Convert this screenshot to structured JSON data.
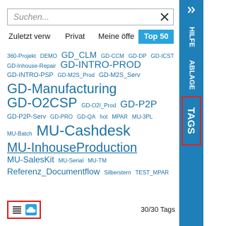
{
  "search": {
    "placeholder": "Suchen...",
    "clear_icon": "close-icon"
  },
  "tabs": [
    {
      "label": "Zuletzt verw"
    },
    {
      "label": "Privat"
    },
    {
      "label": "Meine öffer"
    },
    {
      "label": "Top 50",
      "active": true
    }
  ],
  "tags": [
    {
      "label": "360-Projekt",
      "size": "s1"
    },
    {
      "label": "DEMO",
      "size": "s1"
    },
    {
      "label": "GD_CLM",
      "size": "s3"
    },
    {
      "label": "GD-CCM",
      "size": "s1"
    },
    {
      "label": "GD-DP",
      "size": "s1"
    },
    {
      "label": "GD-ICST",
      "size": "s1"
    },
    {
      "label": "GD-Inhouse-Repair",
      "size": "s1"
    },
    {
      "label": "GD-INTRO-PROD",
      "size": "s4"
    },
    {
      "label": "GD-INTRO-PSP",
      "size": "s2"
    },
    {
      "label": "GD-M2S_Prod",
      "size": "s1"
    },
    {
      "label": "GD-M2S_Serv",
      "size": "s2"
    },
    {
      "label": "GD-Manufacturing",
      "size": "s6"
    },
    {
      "label": "GD-O2CSP",
      "size": "s6"
    },
    {
      "label": "GD-O2I_Prod",
      "size": "s1"
    },
    {
      "label": "GD-P2P",
      "size": "s4"
    },
    {
      "label": "GD-P2P-Serv",
      "size": "s2"
    },
    {
      "label": "GD-PRO",
      "size": "s1"
    },
    {
      "label": "GD-QA",
      "size": "s1"
    },
    {
      "label": "hot",
      "size": "s1"
    },
    {
      "label": "MPAR",
      "size": "s1"
    },
    {
      "label": "MU-3PL",
      "size": "s1"
    },
    {
      "label": "MU-Batch",
      "size": "s1"
    },
    {
      "label": "MU-Cashdesk",
      "size": "s7"
    },
    {
      "label": "MU-InhouseProduction",
      "size": "s5"
    },
    {
      "label": "MU-SalesKit",
      "size": "s3"
    },
    {
      "label": "MU-Serial",
      "size": "s1"
    },
    {
      "label": "MU-TM",
      "size": "s1"
    },
    {
      "label": "Referenz_Documentflow",
      "size": "s3"
    },
    {
      "label": "Silberstern",
      "size": "s1"
    },
    {
      "label": "TEST_MPAR",
      "size": "s1"
    }
  ],
  "footer": {
    "count_label": "30/30 Tags",
    "list_view_icon": "list-icon",
    "cloud_view_icon": "cloud-icon"
  },
  "sidebar": {
    "collapse_icon": "double-chevron-right-icon",
    "items": [
      {
        "label": "HILFE"
      },
      {
        "label": "ABLAGE"
      },
      {
        "label": "TAGS",
        "active": true
      }
    ]
  },
  "colors": {
    "accent": "#2aa4dc",
    "sidebar": "#1f7fb8",
    "tag_text": "#1a6fa3",
    "highlight_border": "#e02424"
  }
}
